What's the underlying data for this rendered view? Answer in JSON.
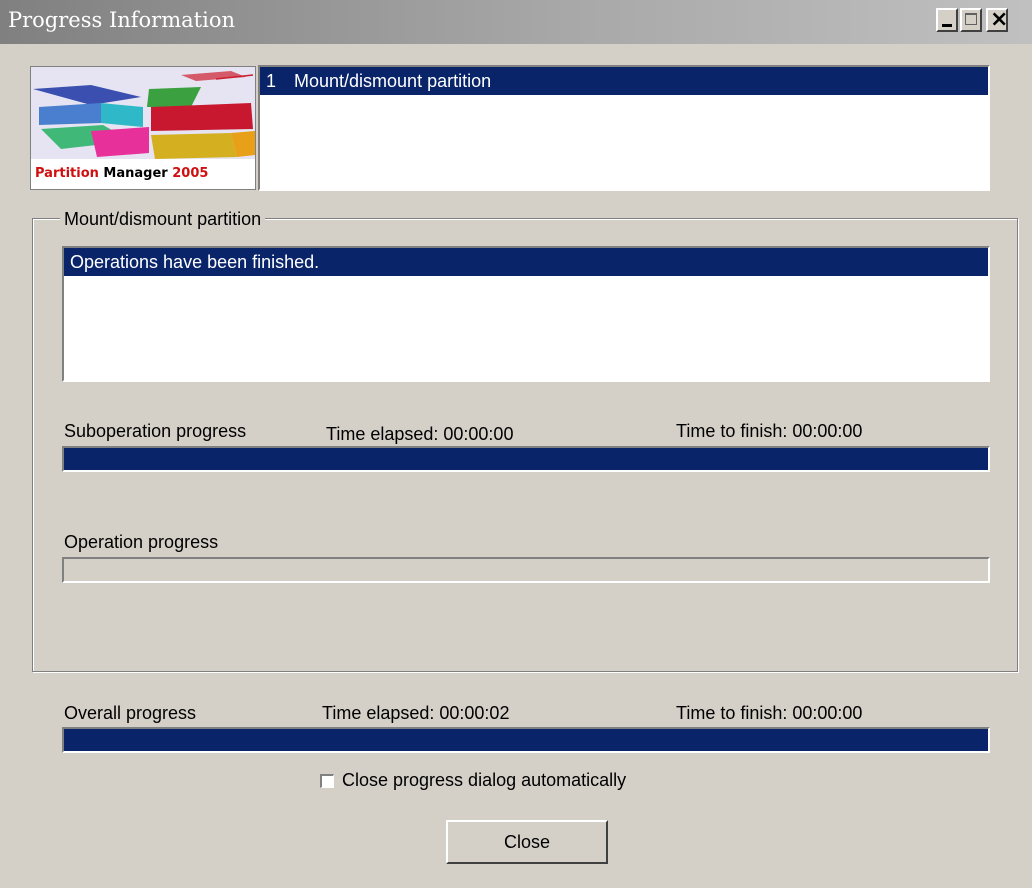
{
  "window": {
    "title": "Progress Information",
    "controls": {
      "minimize": "minimize-icon",
      "maximize": "maximize-icon",
      "close": "close-icon"
    }
  },
  "logo": {
    "brand_word1": "Partition",
    "brand_word2": "Manager",
    "brand_year": "2005"
  },
  "operations": [
    {
      "number": "1",
      "name": "Mount/dismount partition",
      "selected": true
    }
  ],
  "current_operation": {
    "group_title": "Mount/dismount partition",
    "messages": [
      "Operations have been finished."
    ],
    "suboperation": {
      "label": "Suboperation progress",
      "elapsed": "Time elapsed: 00:00:00",
      "remaining": "Time to finish: 00:00:00",
      "progress": 1.0
    },
    "operation": {
      "label": "Operation progress",
      "progress": 0.0
    }
  },
  "overall": {
    "label": "Overall progress",
    "elapsed": "Time elapsed: 00:00:02",
    "remaining": "Time to finish: 00:00:00",
    "progress": 1.0
  },
  "options": {
    "auto_close_label": "Close progress dialog automatically",
    "auto_close_checked": false
  },
  "buttons": {
    "close_label": "Close"
  },
  "colors": {
    "selection": "#0a246a",
    "face": "#d4d0c8"
  }
}
